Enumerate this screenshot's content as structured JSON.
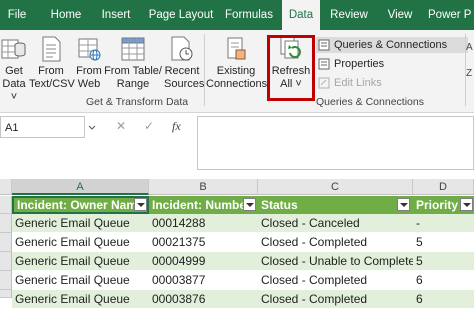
{
  "tabs": [
    "File",
    "Home",
    "Insert",
    "Page Layout",
    "Formulas",
    "Data",
    "Review",
    "View",
    "Power P"
  ],
  "active_tab": "Data",
  "ribbon": {
    "get_data": {
      "line1": "Get",
      "line2": "Data ˅"
    },
    "from_text_csv": {
      "line1": "From",
      "line2": "Text/CSV"
    },
    "from_web": {
      "line1": "From",
      "line2": "Web"
    },
    "from_table_range": {
      "line1": "From Table/",
      "line2": "Range"
    },
    "recent_sources": {
      "line1": "Recent",
      "line2": "Sources"
    },
    "existing_connections": {
      "line1": "Existing",
      "line2": "Connections"
    },
    "refresh_all": {
      "line1": "Refresh",
      "line2": "All ˅"
    },
    "queries_connections": "Queries & Connections",
    "properties": "Properties",
    "edit_links": "Edit Links",
    "group_get_transform": "Get & Transform Data",
    "group_queries": "Queries & Connections"
  },
  "formula_bar": {
    "name_box": "A1",
    "cancel": "✕",
    "enter": "✓",
    "fx": "fx"
  },
  "columns": [
    "A",
    "B",
    "C",
    "D"
  ],
  "table": {
    "headers": [
      "Incident: Owner Name",
      "Incident: Number",
      "Status",
      "Priority"
    ],
    "rows": [
      [
        "Generic Email Queue",
        "00014288",
        "Closed - Canceled",
        "-"
      ],
      [
        "Generic Email Queue",
        "00021375",
        "Closed - Completed",
        "5"
      ],
      [
        "Generic Email Queue",
        "00004999",
        "Closed - Unable to Complete",
        "5"
      ],
      [
        "Generic Email Queue",
        "00003877",
        "Closed - Completed",
        "6"
      ],
      [
        "Generic Email Queue",
        "00003876",
        "Closed - Completed",
        "6"
      ]
    ]
  },
  "colors": {
    "excel_green": "#217346",
    "table_header": "#70ad47",
    "band": "#e2efda",
    "highlight": "#c00000"
  }
}
